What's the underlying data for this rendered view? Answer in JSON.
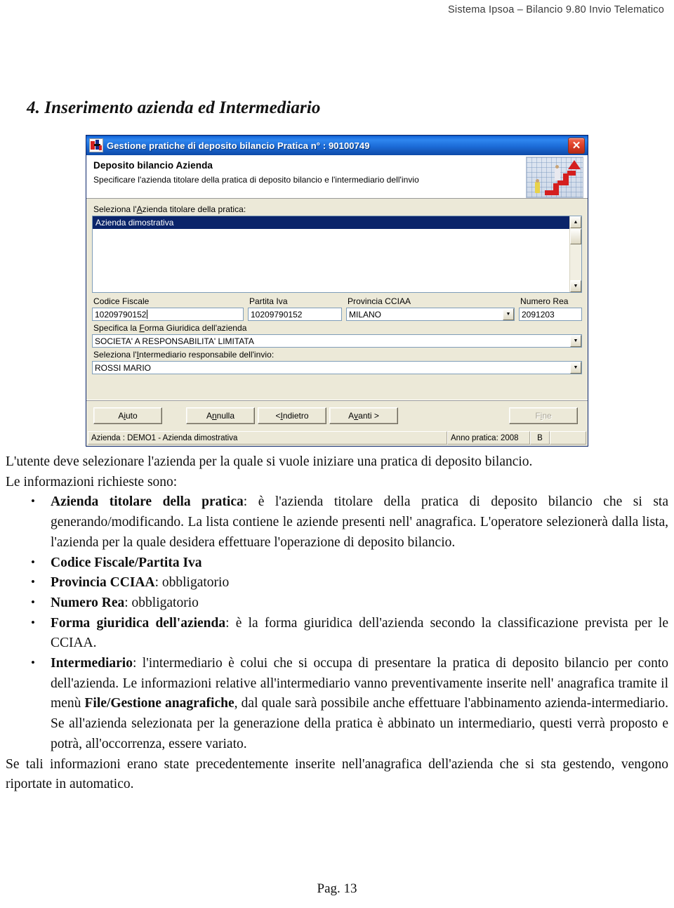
{
  "running_header": "Sistema Ipsoa – Bilancio 9.80 Invio Telematico",
  "section": {
    "heading": "4. Inserimento azienda ed Intermediario"
  },
  "dialog": {
    "title": "Gestione pratiche di deposito bilancio Pratica n° :  90100749",
    "close_label": "✕",
    "header_title": "Deposito bilancio Azienda",
    "header_subtitle": "Specificare l'azienda titolare della pratica di deposito bilancio e l'intermediario dell'invio",
    "list_label_pre": "Seleziona l'",
    "list_label_accel": "A",
    "list_label_post": "zienda titolare della pratica:",
    "list_selected_item": "Azienda dimostrativa",
    "fields": {
      "codice_fiscale_label": "Codice Fiscale",
      "codice_fiscale_value": "10209790152",
      "partita_iva_label": "Partita Iva",
      "partita_iva_value": "10209790152",
      "provincia_cciaa_label": "Provincia CCIAA",
      "provincia_cciaa_value": "MILANO",
      "numero_rea_label": "Numero Rea",
      "numero_rea_value": "2091203"
    },
    "forma_label_pre": "Specifica la ",
    "forma_label_accel": "F",
    "forma_label_post": "orma Giuridica dell'azienda",
    "forma_value": "SOCIETA' A RESPONSABILITA' LIMITATA",
    "intermediario_label_pre": "Seleziona l'",
    "intermediario_label_accel": "I",
    "intermediario_label_post": "ntermediario responsabile dell'invio:",
    "intermediario_value": "ROSSI MARIO",
    "buttons": {
      "aiuto": {
        "pre": "A",
        "accel": "i",
        "post": "uto"
      },
      "annulla": {
        "pre": "A",
        "accel": "n",
        "post": "nulla"
      },
      "indietro": {
        "pre": "< ",
        "accel": "I",
        "post": "ndietro"
      },
      "avanti": {
        "pre": "A",
        "accel": "v",
        "post": "anti >"
      },
      "fine": {
        "pre": "F",
        "accel": "i",
        "post": "ne"
      }
    },
    "status": {
      "azienda": "Azienda : DEMO1 - Azienda dimostrativa",
      "anno_pratica": "Anno pratica: 2008",
      "flag": "B"
    }
  },
  "body": {
    "p1": "L'utente deve selezionare l'azienda per la quale si vuole iniziare una pratica di deposito bilancio.",
    "p2": "Le informazioni richieste sono:",
    "bullets": [
      {
        "bold": "Azienda titolare della pratica",
        "rest": ": è l'azienda titolare della pratica di deposito bilancio che si sta generando/modificando. La lista contiene le aziende presenti nell' anagrafica. L'operatore selezionerà dalla lista, l'azienda per la quale desidera effettuare l'operazione di deposito bilancio."
      },
      {
        "bold": "Codice Fiscale/Partita Iva",
        "rest": ""
      },
      {
        "bold": "Provincia CCIAA",
        "rest": ": obbligatorio"
      },
      {
        "bold": "Numero Rea",
        "rest": ": obbligatorio"
      },
      {
        "bold": "Forma giuridica dell'azienda",
        "rest": ": è la forma giuridica dell'azienda secondo la classificazione prevista per le CCIAA."
      },
      {
        "bold": "Intermediario",
        "rest_a": ": l'intermediario è colui che si occupa di presentare la pratica di deposito bilancio per conto dell'azienda. Le informazioni relative all'intermediario vanno preventivamente inserite nell' anagrafica tramite il menù ",
        "bold2": "File/Gestione anagrafiche",
        "rest_b": ", dal quale sarà possibile anche effettuare l'abbinamento azienda-intermediario. Se all'azienda selezionata per la generazione della pratica è abbinato un intermediario, questi verrà proposto e potrà, all'occorrenza, essere variato."
      }
    ],
    "p3": "Se tali informazioni erano state precedentemente inserite nell'anagrafica dell'azienda che si sta gestendo, vengono riportate in automatico."
  },
  "footer": {
    "page": "Pag. 13"
  }
}
